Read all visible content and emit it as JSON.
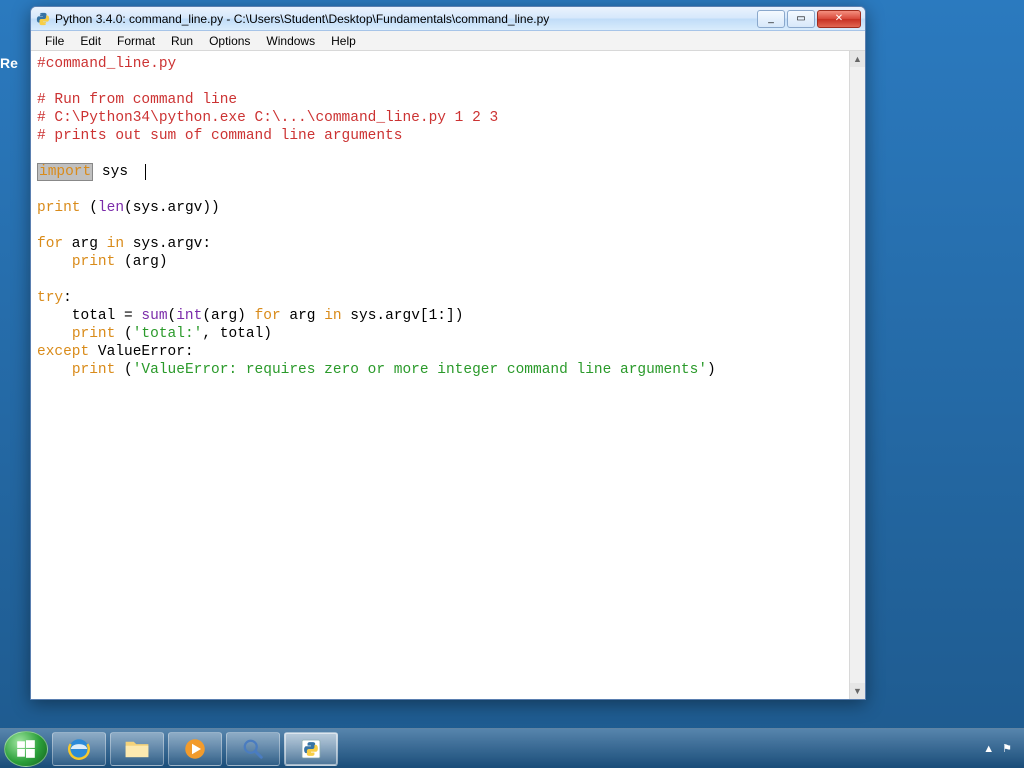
{
  "desktop": {
    "partial_label": "Re"
  },
  "window": {
    "title": "Python 3.4.0: command_line.py - C:\\Users\\Student\\Desktop\\Fundamentals\\command_line.py",
    "icon": "python-icon"
  },
  "menubar": {
    "items": [
      "File",
      "Edit",
      "Format",
      "Run",
      "Options",
      "Windows",
      "Help"
    ]
  },
  "code": {
    "line1": "#command_line.py",
    "line3": "# Run from command line",
    "line4": "# C:\\Python34\\python.exe C:\\...\\command_line.py 1 2 3",
    "line5": "# prints out sum of command line arguments",
    "kw_import": "import",
    "sys": " sys  ",
    "kw_print1": "print",
    "len_call": " (len(sys.argv))",
    "builtin_len": "len",
    "kw_for": "for",
    "for_mid": " arg ",
    "kw_in": "in",
    "for_tail": " sys.argv:",
    "indent": "    ",
    "print_arg": " (arg)",
    "kw_try": "try",
    "colon": ":",
    "total_eq": "    total = ",
    "builtin_sum": "sum",
    "sum_open": "(",
    "builtin_int": "int",
    "sum_mid": "(arg) ",
    "sum_tail": " sys.argv[1:])",
    "print_total_pre": " (",
    "str_total": "'total:'",
    "print_total_post": ", total)",
    "kw_except": "except",
    "valerr": " ValueError:",
    "str_valerr": "'ValueError: requires zero or more integer command line arguments'",
    "print_valerr_close": ")"
  },
  "taskbar": {
    "items": [
      "start",
      "ie",
      "explorer",
      "wmplayer",
      "magnifier",
      "idle"
    ]
  },
  "tray": {
    "flag": "⚑",
    "arrow": "▲"
  },
  "win_controls": {
    "min": "_",
    "max": "▭",
    "close": "✕"
  },
  "scroll": {
    "up": "▲",
    "down": "▼"
  }
}
